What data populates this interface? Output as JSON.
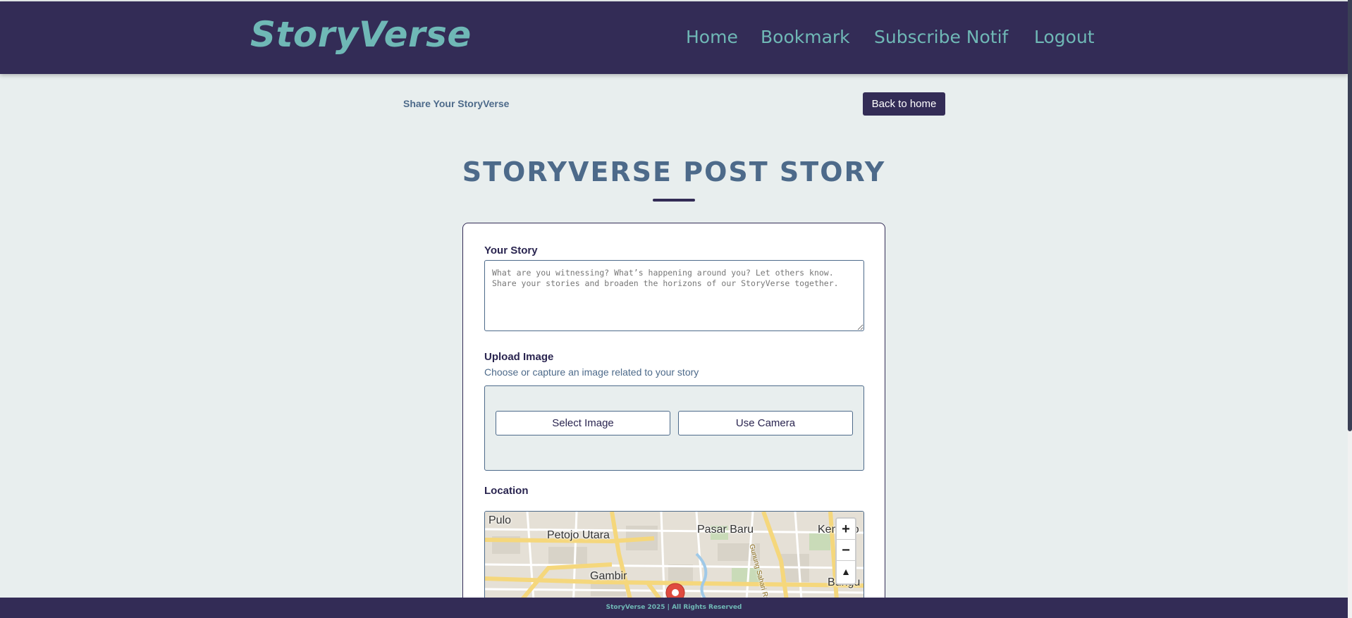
{
  "header": {
    "logo": "StoryVerse",
    "nav": [
      "Home",
      "Bookmark",
      "Subscribe Notif",
      "Logout"
    ]
  },
  "subheader": {
    "title": "Share Your StoryVerse",
    "back_button": "Back to home"
  },
  "page_title": "STORYVERSE POST STORY",
  "form": {
    "story_label": "Your Story",
    "story_placeholder": "What are you witnessing? What’s happening around you? Let others know. Share your stories and broaden the horizons of our StoryVerse together.",
    "upload_label": "Upload Image",
    "upload_hint": "Choose or capture an image related to your story",
    "select_image": "Select Image",
    "use_camera": "Use Camera",
    "location_label": "Location"
  },
  "map": {
    "labels": [
      "Pulo",
      "Petojo Utara",
      "Pasar Baru",
      "Kemayo",
      "Gambir",
      "Bungu",
      "Gunung Sahari Raya"
    ],
    "zoom_in": "+",
    "zoom_out": "−",
    "reset": "▲"
  },
  "footer": "StoryVerse 2025 | All Rights Reserved"
}
